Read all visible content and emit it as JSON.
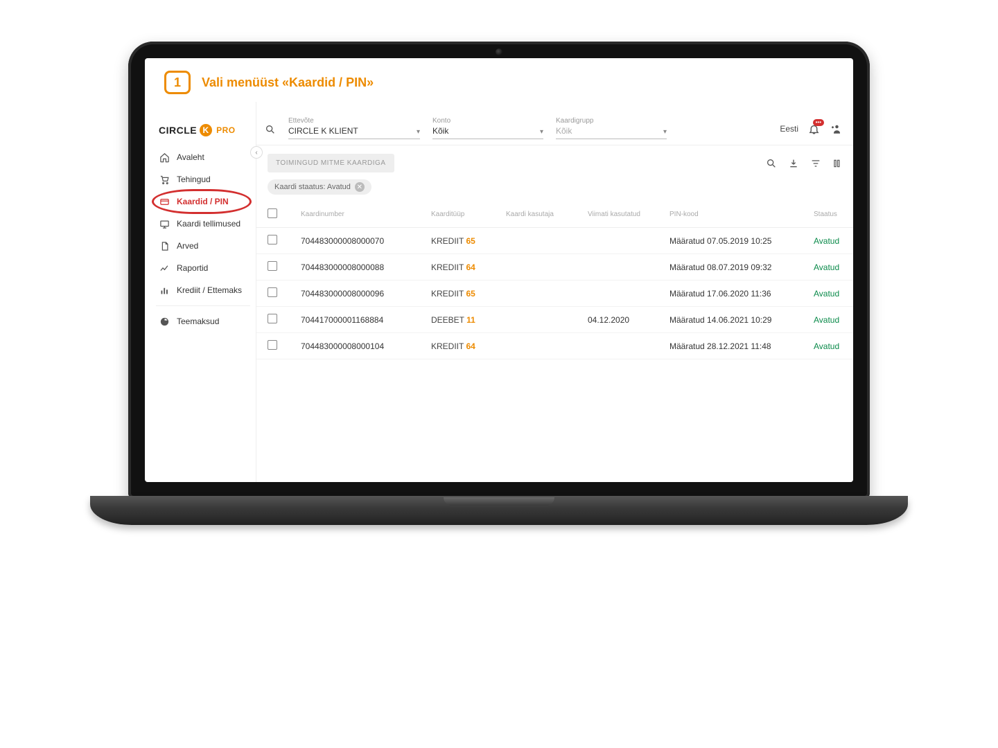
{
  "callout": {
    "number": "1",
    "text": "Vali menüüst «Kaardid / PIN»"
  },
  "brand": {
    "text_circle": "CIRCLE",
    "text_k": "K",
    "text_pro": "PRO"
  },
  "sidebar": {
    "items": [
      {
        "label": "Avaleht"
      },
      {
        "label": "Tehingud"
      },
      {
        "label": "Kaardid / PIN"
      },
      {
        "label": "Kaardi tellimused"
      },
      {
        "label": "Arved"
      },
      {
        "label": "Raportid"
      },
      {
        "label": "Krediit / Ettemaks"
      },
      {
        "label": "Teemaksud"
      }
    ]
  },
  "filters": {
    "company": {
      "label": "Ettevõte",
      "value": "CIRCLE K KLIENT"
    },
    "account": {
      "label": "Konto",
      "value": "Kõik"
    },
    "cardgroup": {
      "label": "Kaardigrupp",
      "placeholder": "Kõik"
    }
  },
  "topright": {
    "language": "Eesti"
  },
  "toolbar": {
    "bulk_label": "TOIMINGUD MITME KAARDIGA"
  },
  "chip": {
    "text": "Kaardi staatus: Avatud"
  },
  "table": {
    "headers": {
      "number": "Kaardinumber",
      "type": "Kaarditüüp",
      "user": "Kaardi kasutaja",
      "last_used": "Viimati kasutatud",
      "pin": "PIN-kood",
      "status": "Staatus"
    },
    "rows": [
      {
        "number": "704483000008000070",
        "type_name": "KREDIIT",
        "type_num": "65",
        "user": "",
        "last_used": "",
        "pin": "Määratud 07.05.2019 10:25",
        "status": "Avatud"
      },
      {
        "number": "704483000008000088",
        "type_name": "KREDIIT",
        "type_num": "64",
        "user": "",
        "last_used": "",
        "pin": "Määratud 08.07.2019 09:32",
        "status": "Avatud"
      },
      {
        "number": "704483000008000096",
        "type_name": "KREDIIT",
        "type_num": "65",
        "user": "",
        "last_used": "",
        "pin": "Määratud 17.06.2020 11:36",
        "status": "Avatud"
      },
      {
        "number": "704417000001168884",
        "type_name": "DEEBET",
        "type_num": "11",
        "user": "",
        "last_used": "04.12.2020",
        "pin": "Määratud 14.06.2021 10:29",
        "status": "Avatud"
      },
      {
        "number": "704483000008000104",
        "type_name": "KREDIIT",
        "type_num": "64",
        "user": "",
        "last_used": "",
        "pin": "Määratud 28.12.2021 11:48",
        "status": "Avatud"
      }
    ]
  }
}
